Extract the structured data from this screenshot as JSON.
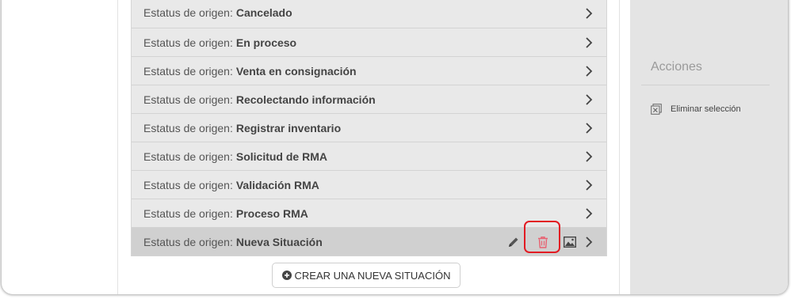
{
  "list": {
    "prefix": "Estatus de origen:",
    "rows": [
      {
        "value": "Cancelado"
      },
      {
        "value": "En proceso"
      },
      {
        "value": "Venta en consignación"
      },
      {
        "value": "Recolectando información"
      },
      {
        "value": "Registrar inventario"
      },
      {
        "value": "Solicitud de RMA"
      },
      {
        "value": "Validación RMA"
      },
      {
        "value": "Proceso RMA"
      },
      {
        "value": "Nueva Situación"
      }
    ]
  },
  "create_button": {
    "label": "CREAR UNA NUEVA SITUACIÓN"
  },
  "side_panel": {
    "title": "Acciones",
    "items": [
      {
        "label": "Eliminar selección"
      }
    ]
  },
  "colors": {
    "highlight": "#e21b23",
    "trash": "#e86070",
    "row_bg": "#e9e9e9",
    "row_selected_bg": "#d0d0d0",
    "side_bg": "#e4e4e4"
  }
}
